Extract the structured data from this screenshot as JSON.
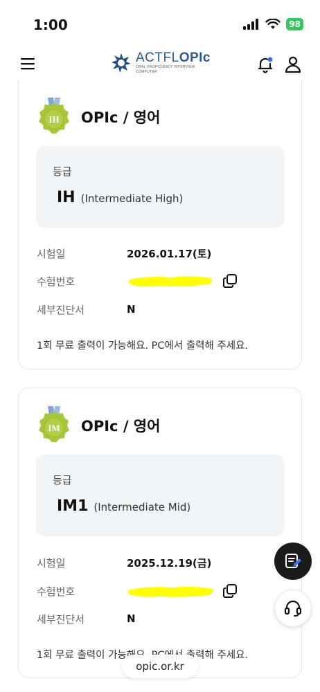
{
  "status_bar": {
    "time": "1:00",
    "battery": "98"
  },
  "header": {
    "logo_word_a": "ACTFL",
    "logo_word_b": "OPIc",
    "logo_sub1": "ORAL PROFICIENCY INTERVIEW",
    "logo_sub2": "COMPUTER"
  },
  "cards": [
    {
      "medal": "IH",
      "title": "OPIc / 영어",
      "grade_label": "등급",
      "grade_code": "IH",
      "grade_desc": "(Intermediate High)",
      "date_label": "시험일",
      "date_value": "2026.01.17(토)",
      "id_label": "수험번호",
      "detail_label": "세부진단서",
      "detail_value": "N",
      "notice": "1회 무료 출력이 가능해요. PC에서 출력해 주세요."
    },
    {
      "medal": "IM",
      "title": "OPIc / 영어",
      "grade_label": "등급",
      "grade_code": "IM1",
      "grade_desc": "(Intermediate Mid)",
      "date_label": "시험일",
      "date_value": "2025.12.19(금)",
      "id_label": "수험번호",
      "detail_label": "세부진단서",
      "detail_value": "N",
      "notice": "1회 무료 출력이 가능해요. PC에서 출력해 주세요."
    }
  ],
  "url_bar": "opic.or.kr",
  "colors": {
    "medal_gold": "#a9c63a",
    "medal_ribbon": "#7fa6d6",
    "redaction": "#ffff00",
    "logo_blue": "#2a5a96"
  }
}
